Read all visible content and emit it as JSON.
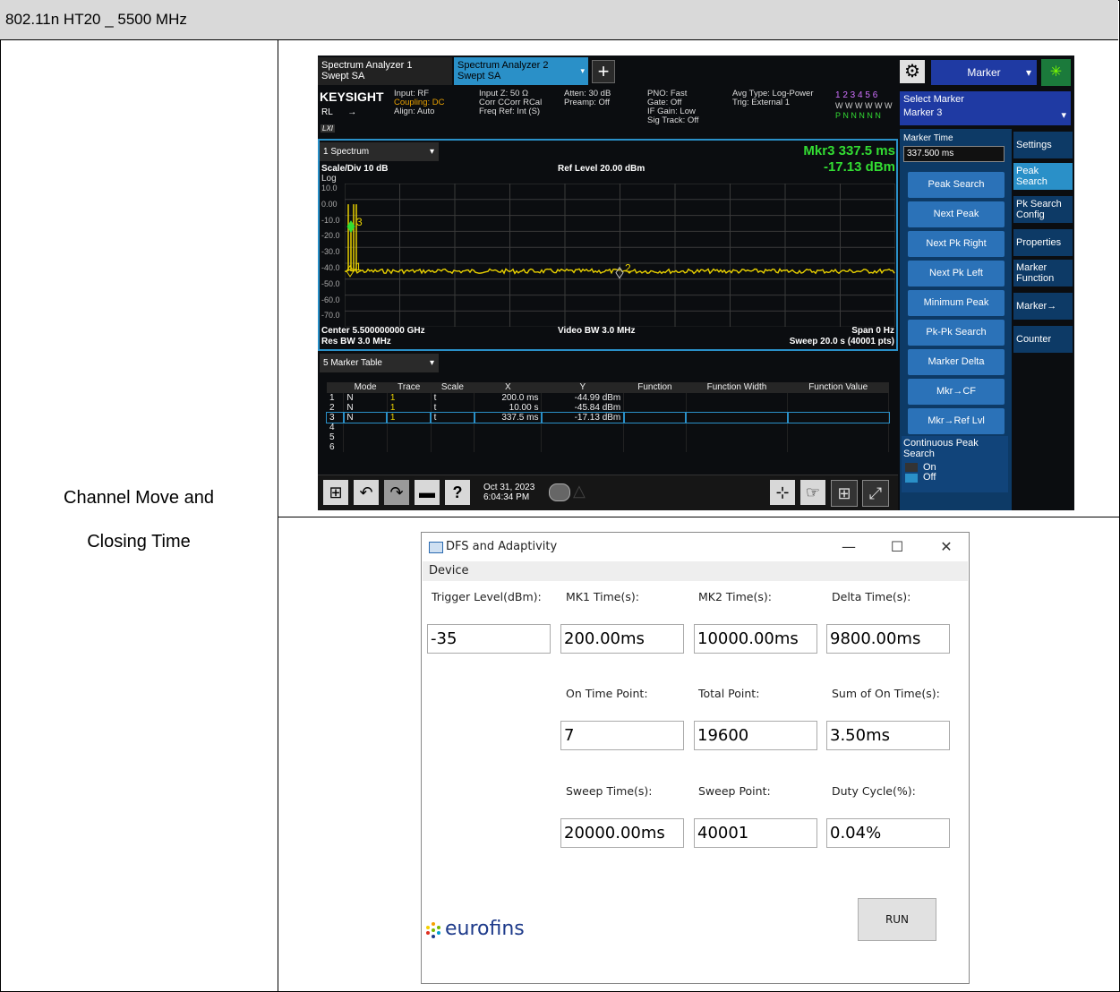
{
  "report": {
    "header": "802.11n HT20 _ 5500 MHz",
    "row_label_line1": "Channel Move and",
    "row_label_line2": "Closing Time"
  },
  "analyzer": {
    "tab1_line1": "Spectrum Analyzer 1",
    "tab1_line2": "Swept SA",
    "tab2_line1": "Spectrum Analyzer 2",
    "tab2_line2": "Swept SA",
    "menu_title": "Marker",
    "brand": "KEYSIGHT",
    "rl": "RL",
    "lxi": "LXI",
    "info_input": "Input: RF",
    "info_coupling": "Coupling: DC",
    "info_align": "Align: Auto",
    "info_inputz": "Input Z: 50 Ω",
    "info_corr": "Corr CCorr RCal",
    "info_freqref": "Freq Ref: Int (S)",
    "info_atten": "Atten: 30 dB",
    "info_preamp": "Preamp: Off",
    "info_pno": "PNO: Fast",
    "info_gate": "Gate: Off",
    "info_ifgain": "IF Gain: Low",
    "info_sigtrack": "Sig Track: Off",
    "info_avgtype": "Avg Type: Log-Power",
    "info_trig": "Trig: External 1",
    "trace_nums": "1 2 3 4 5 6",
    "trace_w": "W W W W W W",
    "trace_pn": "P N N N N N",
    "select_marker_label": "Select Marker",
    "select_marker_value": "Marker 3",
    "window_spectrum": "1 Spectrum",
    "mkr_readout": "Mkr3  337.5 ms",
    "mkr_dbm": "-17.13 dBm",
    "scale_div": "Scale/Div 10 dB",
    "ref_level": "Ref Level 20.00 dBm",
    "log": "Log",
    "y_ticks": [
      "10.0",
      "0.00",
      "-10.0",
      "-20.0",
      "-30.0",
      "-40.0",
      "-50.0",
      "-60.0",
      "-70.0"
    ],
    "marker_labels": [
      "1",
      "2",
      "3"
    ],
    "center": "Center 5.500000000 GHz",
    "res_bw": "Res BW 3.0 MHz",
    "video_bw": "Video BW 3.0 MHz",
    "span": "Span 0 Hz",
    "sweep": "Sweep 20.0 s (40001 pts)",
    "window_marker_table": "5 Marker Table",
    "table_headers": [
      "",
      "Mode",
      "Trace",
      "Scale",
      "X",
      "Y",
      "Function",
      "Function Width",
      "Function Value"
    ],
    "table_rows": [
      [
        "1",
        "N",
        "1",
        "t",
        "200.0 ms",
        "-44.99 dBm",
        "",
        "",
        ""
      ],
      [
        "2",
        "N",
        "1",
        "t",
        "10.00 s",
        "-45.84 dBm",
        "",
        "",
        ""
      ],
      [
        "3",
        "N",
        "1",
        "t",
        "337.5 ms",
        "-17.13 dBm",
        "",
        "",
        ""
      ],
      [
        "4",
        "",
        "",
        "",
        "",
        "",
        "",
        "",
        ""
      ],
      [
        "5",
        "",
        "",
        "",
        "",
        "",
        "",
        "",
        ""
      ],
      [
        "6",
        "",
        "",
        "",
        "",
        "",
        "",
        "",
        ""
      ]
    ],
    "date": "Oct 31, 2023",
    "time": "6:04:34 PM",
    "marker_time_label": "Marker Time",
    "marker_time_value": "337.500 ms",
    "menu_buttons": [
      "Peak Search",
      "Next Peak",
      "Next Pk Right",
      "Next Pk Left",
      "Minimum Peak",
      "Pk-Pk Search",
      "Marker Delta",
      "Mkr→CF",
      "Mkr→Ref Lvl"
    ],
    "continuous_peak_search": "Continuous Peak Search",
    "cps_on": "On",
    "cps_off": "Off",
    "side_tabs": [
      "Settings",
      "Peak Search",
      "Pk Search Config",
      "Properties",
      "Marker Function",
      "Marker→",
      "Counter"
    ],
    "trace_color": "#e8d000",
    "marker_color": "#33dd33"
  },
  "dfs": {
    "title": "DFS and Adaptivity",
    "menu_device": "Device",
    "trigger_label": "Trigger Level(dBm):",
    "trigger_value": "-35",
    "mk1_label": "MK1 Time(s):",
    "mk1_value": "200.00ms",
    "mk2_label": "MK2 Time(s):",
    "mk2_value": "10000.00ms",
    "delta_label": "Delta Time(s):",
    "delta_value": "9800.00ms",
    "ontp_label": "On Time Point:",
    "ontp_value": "7",
    "total_label": "Total Point:",
    "total_value": "19600",
    "sumon_label": "Sum of On Time(s):",
    "sumon_value": "3.50ms",
    "sweept_label": "Sweep Time(s):",
    "sweept_value": "20000.00ms",
    "sweepp_label": "Sweep Point:",
    "sweepp_value": "40001",
    "duty_label": "Duty Cycle(%):",
    "duty_value": "0.04%",
    "run_label": "RUN",
    "logo_text": "eurofins"
  }
}
